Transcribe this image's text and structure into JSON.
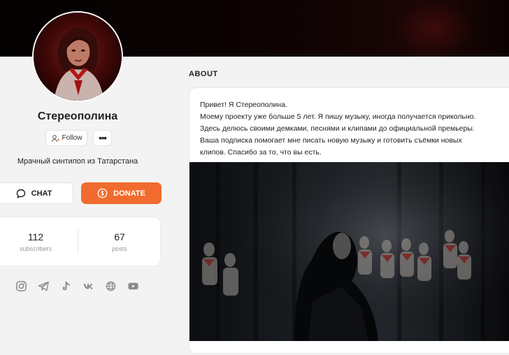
{
  "profile": {
    "name": "Стереополина",
    "tagline": "Мрачный синтипоп из Татарстана",
    "follow_label": "Follow",
    "more_label": "•••"
  },
  "actions": {
    "chat_label": "CHAT",
    "donate_label": "DONATE",
    "accent_color": "#f26b2e"
  },
  "stats": {
    "subscribers": {
      "value": "112",
      "label": "subscribers"
    },
    "posts": {
      "value": "67",
      "label": "posts"
    }
  },
  "socials": [
    "instagram-icon",
    "telegram-icon",
    "tiktok-icon",
    "vk-icon",
    "globe-icon",
    "youtube-icon"
  ],
  "about": {
    "title": "ABOUT",
    "lines": [
      "Привет! Я Стереополина.",
      "Моему проекту уже больше 5 лет. Я пишу музыку, иногда получается прикольно.",
      "Здесь делюсь своими демками, песнями и клипами до официальной премьеры.",
      "Ваша подписка помогает мне писать новую музыку и готовить съёмки новых",
      "клипов. Спасибо за то, что вы есть."
    ]
  }
}
